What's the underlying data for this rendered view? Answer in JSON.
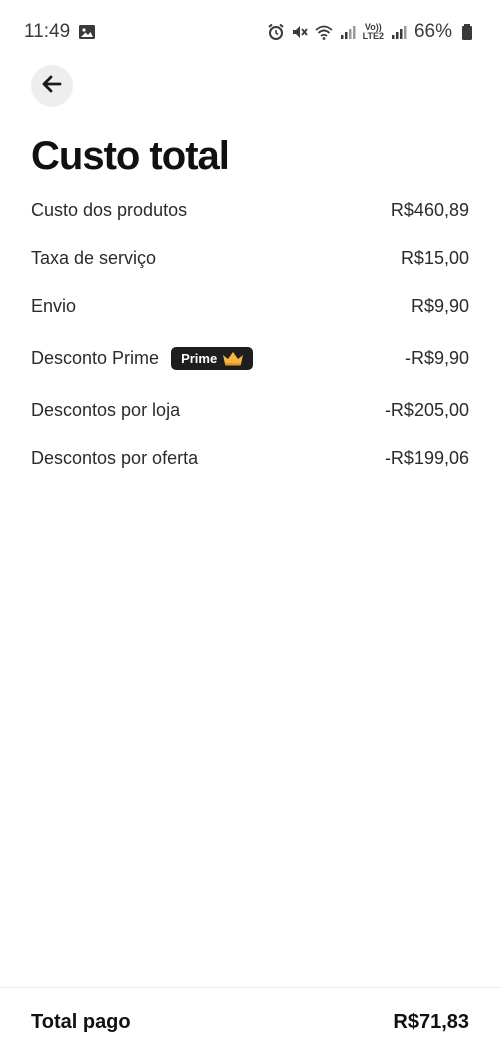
{
  "status_bar": {
    "time": "11:49",
    "lte_top": "Vo))",
    "lte_bottom": "LTE2",
    "battery": "66%"
  },
  "header": {
    "back_icon": "arrow-left-icon"
  },
  "page": {
    "title": "Custo total"
  },
  "costs": [
    {
      "label": "Custo dos produtos",
      "value": "R$460,89"
    },
    {
      "label": "Taxa de serviço",
      "value": "R$15,00"
    },
    {
      "label": "Envio",
      "value": "R$9,90"
    },
    {
      "label": "Desconto Prime",
      "badge": "Prime",
      "value": "-R$9,90"
    },
    {
      "label": "Descontos por loja",
      "value": "-R$205,00"
    },
    {
      "label": "Descontos por oferta",
      "value": "-R$199,06"
    }
  ],
  "footer": {
    "total_label": "Total pago",
    "total_value": "R$71,83"
  },
  "colors": {
    "badge_bg": "#1e1e1e",
    "crown": "#f5b53f",
    "back_button_bg": "#eeeeef"
  }
}
